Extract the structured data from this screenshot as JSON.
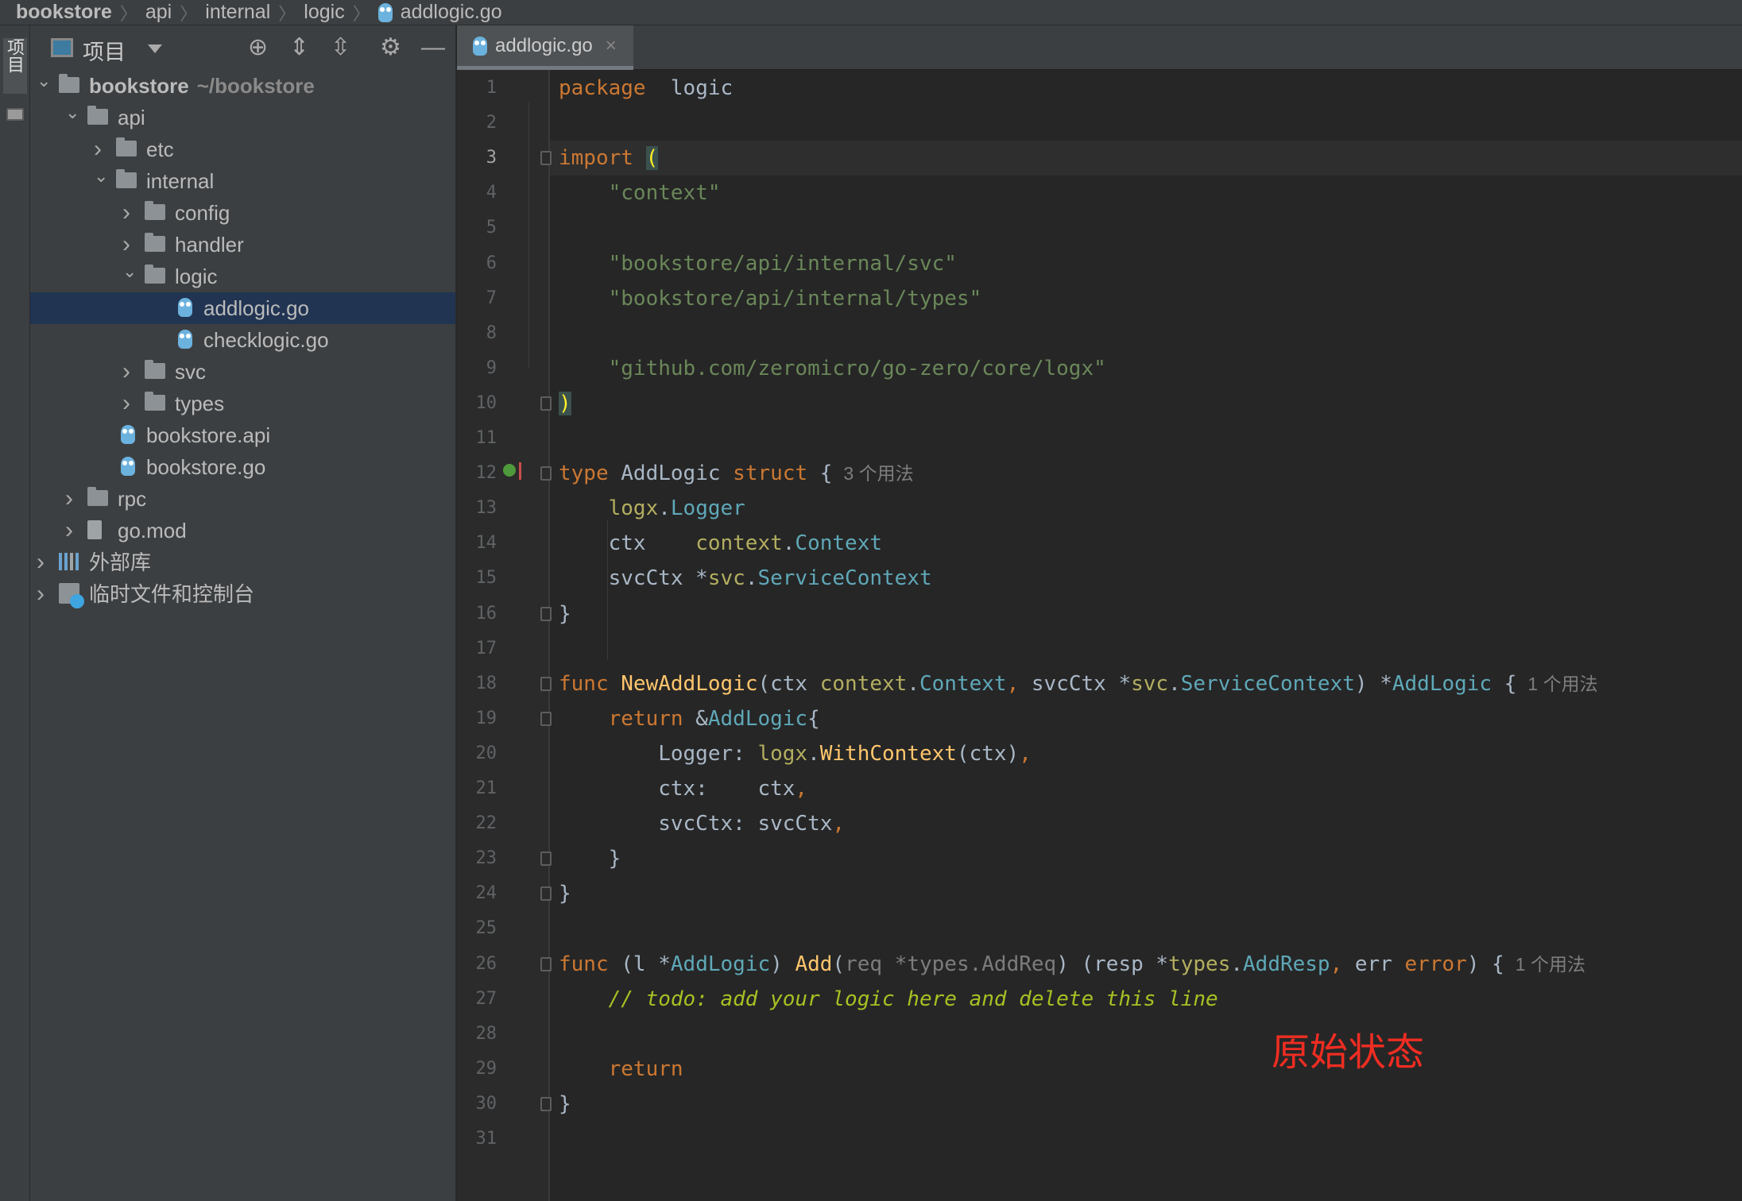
{
  "breadcrumb": [
    "bookstore",
    "api",
    "internal",
    "logic",
    "addlogic.go"
  ],
  "sidebar_strip": {
    "label": "项目"
  },
  "project_panel": {
    "title": "项目",
    "toolbar_icons": [
      "locate-icon",
      "expand-all-icon",
      "collapse-all-icon",
      "gear-icon",
      "minimize-icon"
    ],
    "tree": [
      {
        "label": "bookstore",
        "suffix": "~/bookstore",
        "level": 0,
        "kind": "folder",
        "expanded": true,
        "bold": true
      },
      {
        "label": "api",
        "level": 1,
        "kind": "folder",
        "expanded": true
      },
      {
        "label": "etc",
        "level": 2,
        "kind": "folder",
        "expanded": false
      },
      {
        "label": "internal",
        "level": 2,
        "kind": "folder",
        "expanded": true
      },
      {
        "label": "config",
        "level": 3,
        "kind": "folder",
        "expanded": false
      },
      {
        "label": "handler",
        "level": 3,
        "kind": "folder",
        "expanded": false
      },
      {
        "label": "logic",
        "level": 3,
        "kind": "folder",
        "expanded": true
      },
      {
        "label": "addlogic.go",
        "level": 4,
        "kind": "go",
        "selected": true
      },
      {
        "label": "checklogic.go",
        "level": 4,
        "kind": "go"
      },
      {
        "label": "svc",
        "level": 3,
        "kind": "folder",
        "expanded": false
      },
      {
        "label": "types",
        "level": 3,
        "kind": "folder",
        "expanded": false
      },
      {
        "label": "bookstore.api",
        "level": 2,
        "kind": "go"
      },
      {
        "label": "bookstore.go",
        "level": 2,
        "kind": "go"
      },
      {
        "label": "rpc",
        "level": 1,
        "kind": "folder",
        "expanded": false
      },
      {
        "label": "go.mod",
        "level": 1,
        "kind": "mod",
        "expanded": false
      },
      {
        "label": "外部库",
        "level": 0,
        "kind": "lib",
        "expanded": false
      },
      {
        "label": "临时文件和控制台",
        "level": 0,
        "kind": "scratch",
        "expanded": false
      }
    ]
  },
  "tab": {
    "label": "addlogic.go",
    "close": "×"
  },
  "editor": {
    "current_line": 3,
    "lines": [
      [
        [
          "kw",
          "package"
        ],
        [
          "",
          "  "
        ],
        [
          "",
          "logic"
        ]
      ],
      [],
      [
        [
          "kw",
          "import"
        ],
        [
          "",
          " "
        ],
        [
          "brk",
          "("
        ]
      ],
      [
        [
          "",
          "    "
        ],
        [
          "str",
          "\"context\""
        ]
      ],
      [],
      [
        [
          "",
          "    "
        ],
        [
          "str",
          "\"bookstore/api/internal/svc\""
        ]
      ],
      [
        [
          "",
          "    "
        ],
        [
          "str",
          "\"bookstore/api/internal/types\""
        ]
      ],
      [],
      [
        [
          "",
          "    "
        ],
        [
          "str",
          "\"github.com/zeromicro/go-zero/core/logx\""
        ]
      ],
      [
        [
          "brk",
          ")"
        ]
      ],
      [],
      [
        [
          "kw",
          "type"
        ],
        [
          "",
          " AddLogic "
        ],
        [
          "kw",
          "struct"
        ],
        [
          "",
          " {"
        ],
        [
          "hint",
          "3 个用法"
        ]
      ],
      [
        [
          "",
          "    "
        ],
        [
          "pkg",
          "logx"
        ],
        [
          "",
          "."
        ],
        [
          "typ",
          "Logger"
        ]
      ],
      [
        [
          "",
          "    ctx    "
        ],
        [
          "pkg",
          "context"
        ],
        [
          "",
          "."
        ],
        [
          "typ",
          "Context"
        ]
      ],
      [
        [
          "",
          "    svcCtx *"
        ],
        [
          "pkg",
          "svc"
        ],
        [
          "",
          "."
        ],
        [
          "typ",
          "ServiceContext"
        ]
      ],
      [
        [
          "",
          "}"
        ]
      ],
      [],
      [
        [
          "kw",
          "func"
        ],
        [
          "",
          " "
        ],
        [
          "fn",
          "NewAddLogic"
        ],
        [
          "",
          "(ctx "
        ],
        [
          "pkg",
          "context"
        ],
        [
          "",
          "."
        ],
        [
          "typ",
          "Context"
        ],
        [
          "com",
          ","
        ],
        [
          "",
          " svcCtx *"
        ],
        [
          "pkg",
          "svc"
        ],
        [
          "",
          "."
        ],
        [
          "typ",
          "ServiceContext"
        ],
        [
          "",
          ") *"
        ],
        [
          "typ",
          "AddLogic"
        ],
        [
          "",
          " {"
        ],
        [
          "hint",
          "1 个用法"
        ]
      ],
      [
        [
          "",
          "    "
        ],
        [
          "kw",
          "return"
        ],
        [
          "",
          " &"
        ],
        [
          "typ",
          "AddLogic"
        ],
        [
          "",
          "{"
        ]
      ],
      [
        [
          "",
          "        Logger: "
        ],
        [
          "pkg",
          "logx"
        ],
        [
          "",
          "."
        ],
        [
          "fn",
          "WithContext"
        ],
        [
          "",
          "(ctx)"
        ],
        [
          "com",
          ","
        ]
      ],
      [
        [
          "",
          "        ctx:    ctx"
        ],
        [
          "com",
          ","
        ]
      ],
      [
        [
          "",
          "        svcCtx: svcCtx"
        ],
        [
          "com",
          ","
        ]
      ],
      [
        [
          "",
          "    }"
        ]
      ],
      [
        [
          "",
          "}"
        ]
      ],
      [],
      [
        [
          "kw",
          "func"
        ],
        [
          "",
          " (l *"
        ],
        [
          "typ",
          "AddLogic"
        ],
        [
          "",
          ") "
        ],
        [
          "fn",
          "Add"
        ],
        [
          "",
          "("
        ],
        [
          "un",
          "req *types.AddReq"
        ],
        [
          "",
          ") (resp *"
        ],
        [
          "pkg",
          "types"
        ],
        [
          "",
          "."
        ],
        [
          "typ",
          "AddResp"
        ],
        [
          "com",
          ","
        ],
        [
          "",
          " err "
        ],
        [
          "kw",
          "error"
        ],
        [
          "",
          ") {"
        ],
        [
          "hint",
          "1 个用法"
        ]
      ],
      [
        [
          "",
          "    "
        ],
        [
          "cm",
          "// todo: add your logic here and delete this line"
        ]
      ],
      [],
      [
        [
          "",
          "    "
        ],
        [
          "kw",
          "return"
        ]
      ],
      [
        [
          "",
          "}"
        ]
      ],
      []
    ],
    "fold_markers": [
      3,
      10,
      12,
      16,
      18,
      19,
      23,
      24,
      26,
      30
    ]
  },
  "annotation": {
    "text": "原始状态",
    "color": "#ef2d22"
  }
}
